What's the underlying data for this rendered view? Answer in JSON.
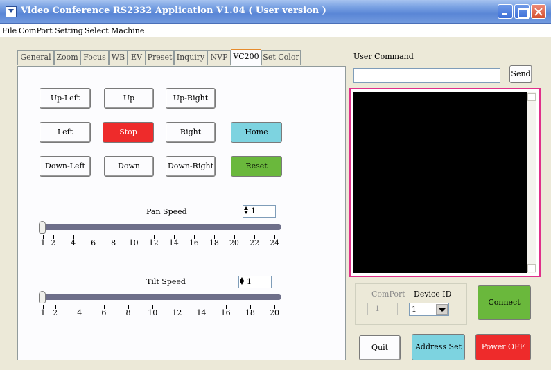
{
  "window": {
    "title": "Video Conference RS2332 Application V1.04 ( User version )"
  },
  "menu": {
    "items": [
      "File",
      "ComPort Setting",
      "Select Machine"
    ]
  },
  "tabs": [
    "General",
    "Zoom",
    "Focus",
    "WB",
    "EV",
    "Preset",
    "Inquiry",
    "NVP",
    "VC200",
    "Set Color"
  ],
  "active_tab": "VC200",
  "ptz": {
    "up_left": "Up-Left",
    "up": "Up",
    "up_right": "Up-Right",
    "left": "Left",
    "stop": "Stop",
    "right": "Right",
    "home": "Home",
    "down_left": "Down-Left",
    "down": "Down",
    "down_right": "Down-Right",
    "reset": "Reset"
  },
  "pan_speed": {
    "label": "Pan Speed",
    "value": "1",
    "ticks": [
      "1",
      "2",
      "4",
      "6",
      "8",
      "10",
      "12",
      "14",
      "16",
      "18",
      "20",
      "22",
      "24"
    ]
  },
  "tilt_speed": {
    "label": "Tilt Speed",
    "value": "1",
    "ticks": [
      "1",
      "2",
      "4",
      "6",
      "8",
      "10",
      "12",
      "14",
      "16",
      "18",
      "20"
    ]
  },
  "user_command": {
    "label": "User Command",
    "value": "",
    "send": "Send"
  },
  "connection": {
    "comport_label": "ComPort",
    "comport_value": "1",
    "device_id_label": "Device ID",
    "device_id_value": "1",
    "connect": "Connect"
  },
  "actions": {
    "quit": "Quit",
    "address_set": "Address Set",
    "power": "Power OFF"
  },
  "colors": {
    "stop": "#ee2b2b",
    "home": "#7dd3e0",
    "reset": "#6ab83c",
    "connect": "#6ab83c",
    "address_set": "#7dd3e0",
    "power": "#ee2b2b",
    "log_frame": "#e0308a"
  }
}
